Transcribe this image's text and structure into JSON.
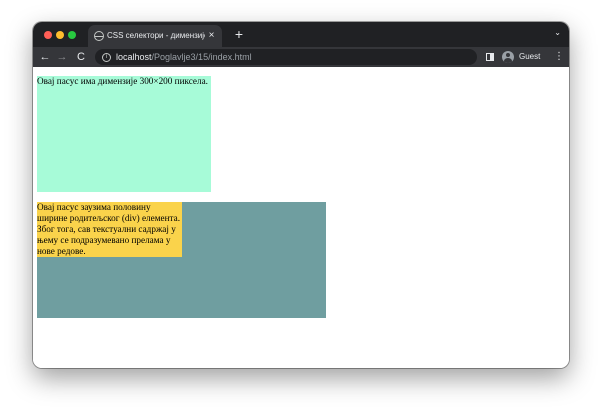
{
  "browser": {
    "tab_title": "CSS селектори - димензије с",
    "tab_close": "×",
    "new_tab": "+",
    "tab_menu": "⌄",
    "url_host": "localhost",
    "url_path": "/Poglavlje3/15/index.html",
    "profile_label": "Guest",
    "back": "←",
    "forward": "→",
    "reload": "C",
    "info": "i",
    "more": "⋮",
    "icons": [
      "close-icon",
      "new-tab-icon",
      "back-icon",
      "forward-icon",
      "reload-icon",
      "info-icon",
      "side-panel-icon",
      "avatar-icon",
      "more-icon"
    ]
  },
  "page": {
    "fixed_box_text": "Овај пасус има димензије 300×200 пиксела.",
    "half_box_text": "Овај пасус заузима половину ширине родитељског (div) елемента. Због тога, сав текстуални садржај у њему се подразумевано прелама у нове редове."
  },
  "colors": {
    "fixed_box": "#a7fbd8",
    "parent_div": "#6f9ea0",
    "half_box": "#fad34b",
    "chrome_dark": "#202124",
    "chrome_toolbar": "#35363a"
  }
}
